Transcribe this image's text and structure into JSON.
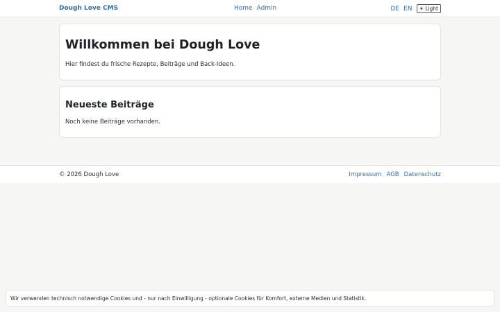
{
  "header": {
    "brand": "Dough Love CMS",
    "nav": [
      "Home",
      "Admin"
    ],
    "languages": [
      "DE",
      "EN"
    ],
    "theme_icon": "☀",
    "theme_label": "Light"
  },
  "hero": {
    "title": "Willkommen bei Dough Love",
    "text": "Hier findest du frische Rezepte, Beiträge und Back-Ideen."
  },
  "posts": {
    "title": "Neueste Beiträge",
    "empty": "Noch keine Beiträge vorhanden."
  },
  "footer": {
    "copyright": "© 2026 Dough Love",
    "links": [
      "Impressum",
      "AGB",
      "Datenschutz"
    ]
  },
  "cookie": {
    "text": "Wir verwenden technisch notwendige Cookies und - nur nach Einwilligung - optionale Cookies für Komfort, externe Medien und Statistik."
  },
  "colors": {
    "link": "#2f6db3",
    "background": "#f6f6f4"
  }
}
